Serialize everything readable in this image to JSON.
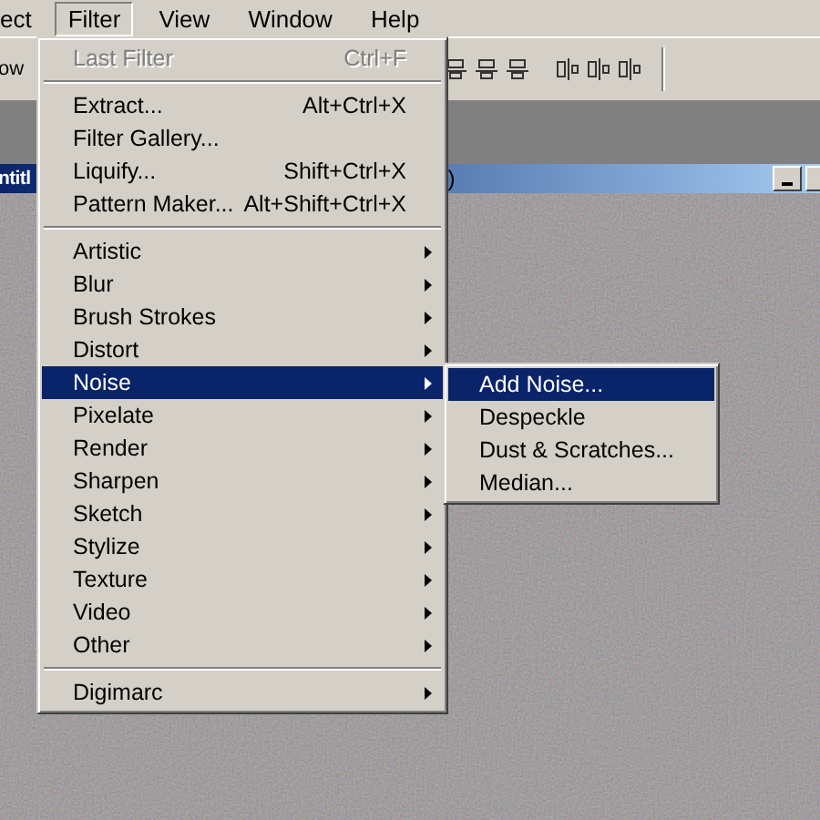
{
  "menubar": [
    {
      "label": "ect",
      "selected": false
    },
    {
      "label": "Filter",
      "selected": true
    },
    {
      "label": "View",
      "selected": false
    },
    {
      "label": "Window",
      "selected": false
    },
    {
      "label": "Help",
      "selected": false
    }
  ],
  "toolbar": {
    "text": "ow"
  },
  "document": {
    "title_parts": [
      "ntitl",
      ")"
    ]
  },
  "filter_menu": [
    {
      "kind": "item",
      "label": "Last Filter",
      "shortcut": "Ctrl+F",
      "disabled": true,
      "submenu": false,
      "selected": false
    },
    {
      "kind": "separator"
    },
    {
      "kind": "item",
      "label": "Extract...",
      "shortcut": "Alt+Ctrl+X",
      "disabled": false,
      "submenu": false,
      "selected": false
    },
    {
      "kind": "item",
      "label": "Filter Gallery...",
      "disabled": false,
      "submenu": false,
      "selected": false
    },
    {
      "kind": "item",
      "label": "Liquify...",
      "shortcut": "Shift+Ctrl+X",
      "disabled": false,
      "submenu": false,
      "selected": false
    },
    {
      "kind": "item",
      "label": "Pattern Maker...",
      "shortcut": "Alt+Shift+Ctrl+X",
      "disabled": false,
      "submenu": false,
      "selected": false
    },
    {
      "kind": "separator"
    },
    {
      "kind": "item",
      "label": "Artistic",
      "disabled": false,
      "submenu": true,
      "selected": false
    },
    {
      "kind": "item",
      "label": "Blur",
      "disabled": false,
      "submenu": true,
      "selected": false
    },
    {
      "kind": "item",
      "label": "Brush Strokes",
      "disabled": false,
      "submenu": true,
      "selected": false
    },
    {
      "kind": "item",
      "label": "Distort",
      "disabled": false,
      "submenu": true,
      "selected": false
    },
    {
      "kind": "item",
      "label": "Noise",
      "disabled": false,
      "submenu": true,
      "selected": true
    },
    {
      "kind": "item",
      "label": "Pixelate",
      "disabled": false,
      "submenu": true,
      "selected": false
    },
    {
      "kind": "item",
      "label": "Render",
      "disabled": false,
      "submenu": true,
      "selected": false
    },
    {
      "kind": "item",
      "label": "Sharpen",
      "disabled": false,
      "submenu": true,
      "selected": false
    },
    {
      "kind": "item",
      "label": "Sketch",
      "disabled": false,
      "submenu": true,
      "selected": false
    },
    {
      "kind": "item",
      "label": "Stylize",
      "disabled": false,
      "submenu": true,
      "selected": false
    },
    {
      "kind": "item",
      "label": "Texture",
      "disabled": false,
      "submenu": true,
      "selected": false
    },
    {
      "kind": "item",
      "label": "Video",
      "disabled": false,
      "submenu": true,
      "selected": false
    },
    {
      "kind": "item",
      "label": "Other",
      "disabled": false,
      "submenu": true,
      "selected": false
    },
    {
      "kind": "separator"
    },
    {
      "kind": "item",
      "label": "Digimarc",
      "disabled": false,
      "submenu": true,
      "selected": false
    }
  ],
  "noise_submenu": [
    {
      "label": "Add Noise...",
      "selected": true
    },
    {
      "label": "Despeckle",
      "selected": false
    },
    {
      "label": "Dust & Scratches...",
      "selected": false
    },
    {
      "label": "Median...",
      "selected": false
    }
  ]
}
